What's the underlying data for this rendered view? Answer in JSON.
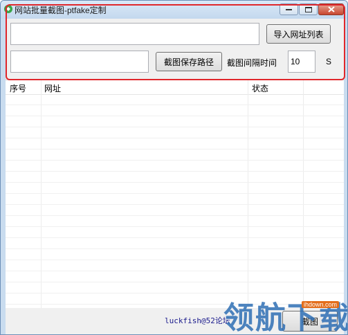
{
  "window": {
    "title": "网站批量截图-ptfake定制"
  },
  "controls": {
    "url_input_value": "",
    "import_button": "导入网址列表",
    "path_input_value": "",
    "save_path_button": "截图保存路径",
    "interval_label": "截图间隔时间",
    "interval_value": "10",
    "interval_unit": "S"
  },
  "table": {
    "columns": [
      "序号",
      "网址",
      "状态"
    ],
    "rows": []
  },
  "footer": {
    "credit": "luckfish@52论坛",
    "capture_button": "截图"
  },
  "watermark": {
    "text": "领航下载",
    "badge": "ihdown.com"
  },
  "colors": {
    "highlight_border": "#e0262b",
    "titlebar": "#c3d8ee"
  }
}
